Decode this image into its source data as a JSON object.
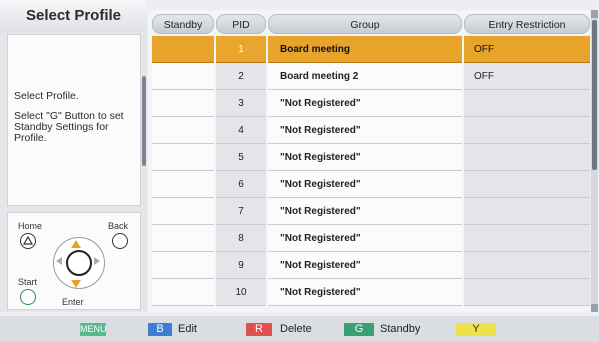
{
  "left": {
    "title": "Select Profile",
    "info_line1": "Select Profile.",
    "info_line2": "Select \"G\" Button to set Standby Settings for Profile."
  },
  "remote": {
    "home": "Home",
    "back": "Back",
    "start": "Start",
    "enter": "Enter"
  },
  "table": {
    "headers": {
      "standby": "Standby",
      "pid": "PID",
      "group": "Group",
      "entry": "Entry Restriction"
    },
    "rows": [
      {
        "standby": "",
        "pid": "1",
        "group": "Board meeting",
        "entry": "OFF"
      },
      {
        "standby": "",
        "pid": "2",
        "group": "Board meeting 2",
        "entry": "OFF"
      },
      {
        "standby": "",
        "pid": "3",
        "group": "\"Not Registered\"",
        "entry": ""
      },
      {
        "standby": "",
        "pid": "4",
        "group": "\"Not Registered\"",
        "entry": ""
      },
      {
        "standby": "",
        "pid": "5",
        "group": "\"Not Registered\"",
        "entry": ""
      },
      {
        "standby": "",
        "pid": "6",
        "group": "\"Not Registered\"",
        "entry": ""
      },
      {
        "standby": "",
        "pid": "7",
        "group": "\"Not Registered\"",
        "entry": ""
      },
      {
        "standby": "",
        "pid": "8",
        "group": "\"Not Registered\"",
        "entry": ""
      },
      {
        "standby": "",
        "pid": "9",
        "group": "\"Not Registered\"",
        "entry": ""
      },
      {
        "standby": "",
        "pid": "10",
        "group": "\"Not Registered\"",
        "entry": ""
      }
    ]
  },
  "bottom": {
    "menu_key": "MENU",
    "b_key": "B",
    "b_label": "Edit",
    "r_key": "R",
    "r_label": "Delete",
    "g_key": "G",
    "g_label": "Standby",
    "y_key": "Y"
  },
  "colors": {
    "selected_row": "#e8a32a",
    "menu": "#58b98a",
    "blue": "#3c7fd0",
    "red": "#e0514e",
    "green": "#3a9f73",
    "yellow": "#efe14a"
  }
}
